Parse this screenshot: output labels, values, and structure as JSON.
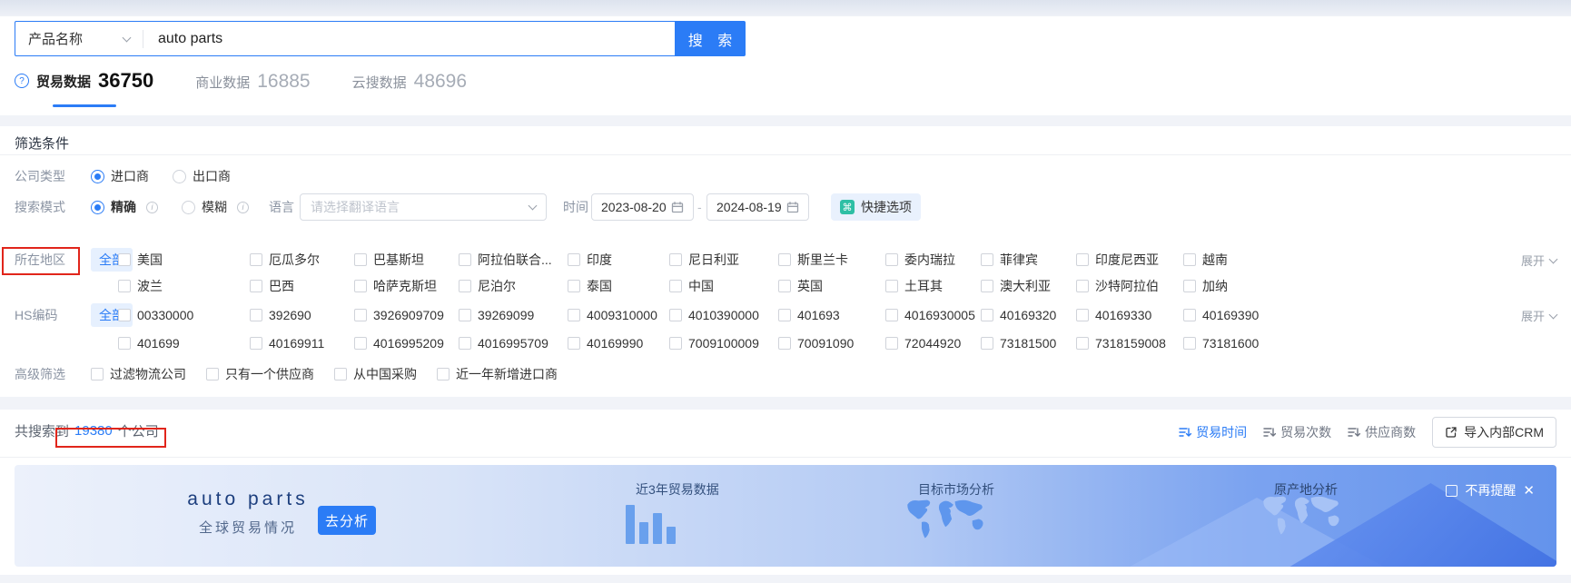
{
  "icons": {
    "question": "?",
    "command": "⌘",
    "close": "✕",
    "info": "i"
  },
  "search": {
    "category_label": "产品名称",
    "query": "auto parts",
    "button_label": "搜 索"
  },
  "tabs": [
    {
      "label": "贸易数据",
      "count": "36750"
    },
    {
      "label": "商业数据",
      "count": "16885"
    },
    {
      "label": "云搜数据",
      "count": "48696"
    }
  ],
  "filter": {
    "title": "筛选条件",
    "company_type": {
      "label": "公司类型",
      "option1": "进口商",
      "option2": "出口商"
    },
    "search_mode": {
      "label": "搜索模式",
      "option1": "精确",
      "option2": "模糊"
    },
    "language": {
      "label": "语言",
      "placeholder": "请选择翻译语言"
    },
    "time": {
      "label": "时间",
      "start": "2023-08-20",
      "end": "2024-08-19",
      "separator": "-"
    },
    "quick_button": "快捷选项",
    "all_label": "全部",
    "expand_label": "展开",
    "region": {
      "label": "所在地区",
      "row1": [
        "美国",
        "厄瓜多尔",
        "巴基斯坦",
        "阿拉伯联合...",
        "印度",
        "尼日利亚",
        "斯里兰卡",
        "委内瑞拉",
        "菲律宾",
        "印度尼西亚",
        "越南"
      ],
      "row2": [
        "波兰",
        "巴西",
        "哈萨克斯坦",
        "尼泊尔",
        "泰国",
        "中国",
        "英国",
        "土耳其",
        "澳大利亚",
        "沙特阿拉伯",
        "加纳"
      ]
    },
    "hscode": {
      "label": "HS编码",
      "row1": [
        "00330000",
        "392690",
        "3926909709",
        "39269099",
        "4009310000",
        "4010390000",
        "401693",
        "4016930005",
        "40169320",
        "40169330",
        "40169390"
      ],
      "row2": [
        "401699",
        "40169911",
        "4016995209",
        "4016995709",
        "40169990",
        "7009100009",
        "70091090",
        "72044920",
        "73181500",
        "7318159008",
        "73181600"
      ]
    },
    "advanced": {
      "label": "高级筛选",
      "options": [
        "过滤物流公司",
        "只有一个供应商",
        "从中国采购",
        "近一年新增进口商"
      ]
    }
  },
  "results": {
    "summary_prefix": "共搜索到",
    "summary_count": "19380",
    "summary_suffix": "个公司",
    "sorts": [
      "贸易时间",
      "贸易次数",
      "供应商数"
    ],
    "active_sort": "贸易时间",
    "crm_button": "导入内部CRM"
  },
  "banner": {
    "title": "auto parts",
    "subtitle": "全球贸易情况",
    "analyze_button": "去分析",
    "section1": "近3年贸易数据",
    "section2": "目标市场分析",
    "section3": "原产地分析",
    "dismiss_label": "不再提醒",
    "bar_chart_heights": [
      43,
      24,
      34,
      19
    ]
  },
  "theme": {
    "primary": "#2b7cf6",
    "annotation_red": "#e1251b",
    "quick_icon_green": "#2ebfa5"
  }
}
